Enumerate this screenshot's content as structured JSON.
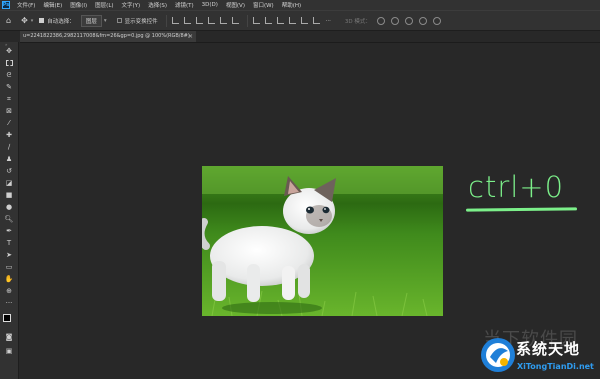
{
  "menubar": {
    "logo": "Ps",
    "items": [
      "文件(F)",
      "编辑(E)",
      "图像(I)",
      "图层(L)",
      "文字(Y)",
      "选择(S)",
      "滤镜(T)",
      "3D(D)",
      "视图(V)",
      "窗口(W)",
      "帮助(H)"
    ]
  },
  "options": {
    "auto_select_label": "自动选择：",
    "auto_select_value": "图层",
    "show_transform_label": "显示变换控件",
    "mode_3d_label": "3D 模式："
  },
  "document": {
    "tab_title": "u=2241822386,2982117008&fm=26&gp=0.jpg @ 100%(RGB/8#)",
    "close_glyph": "×"
  },
  "annotation": {
    "text": "ctrl+0",
    "color": "#7cf08a"
  },
  "watermark": {
    "faint_text": "当下软件园",
    "title": "系统天地",
    "url": "XiTongTianDi.net"
  },
  "tools": [
    "move-icon",
    "marquee-icon",
    "lasso-icon",
    "quick-select-icon",
    "crop-icon",
    "frame-icon",
    "eyedropper-icon",
    "healing-brush-icon",
    "brush-icon",
    "clone-stamp-icon",
    "history-brush-icon",
    "eraser-icon",
    "gradient-icon",
    "blur-icon",
    "dodge-icon",
    "pen-icon",
    "type-icon",
    "path-select-icon",
    "rectangle-icon",
    "hand-icon",
    "zoom-icon",
    "more-tools-icon",
    "color-swatch-icon",
    "quick-mask-icon",
    "screen-mode-icon"
  ]
}
